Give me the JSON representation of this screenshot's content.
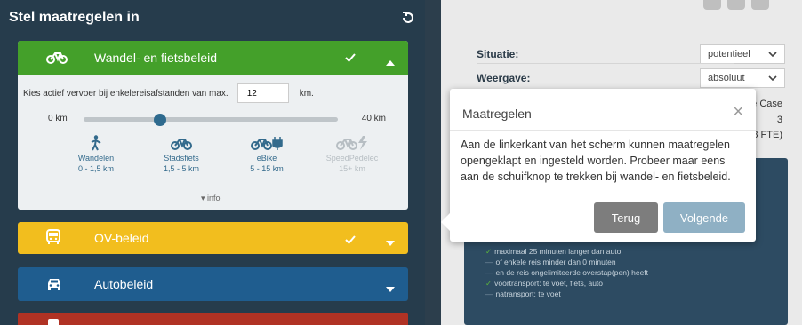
{
  "left_panel": {
    "title": "Stel maatregelen in",
    "sections": {
      "walk_bike": {
        "label": "Wandel- en fietsbeleid",
        "color": "#44a02a",
        "distance_text": "Kies actief vervoer bij enkelereisafstanden van max.",
        "distance_value": "12",
        "distance_unit": "km.",
        "slider_min": "0 km",
        "slider_max": "40 km",
        "slider_fraction": 0.3,
        "modes": [
          {
            "name": "Wandelen",
            "range": "0 - 1,5 km",
            "icon": "walking-icon"
          },
          {
            "name": "Stadsfiets",
            "range": "1,5 - 5 km",
            "icon": "bicycle-icon"
          },
          {
            "name": "eBike",
            "range": "5 - 15 km",
            "icon": "ebike-icon"
          },
          {
            "name": "SpeedPedelec",
            "range": "15+ km",
            "icon": "speedpedelec-icon"
          }
        ],
        "info_label": "info"
      },
      "ov": {
        "label": "OV-beleid",
        "color": "#f2be1e"
      },
      "auto": {
        "label": "Autobeleid",
        "color": "#1f5d8f"
      }
    }
  },
  "right_panel": {
    "situatie_label": "Situatie:",
    "situatie_value": "potentieel",
    "weergave_label": "Weergave:",
    "weergave_value": "absoluut",
    "partial_1": "e Case",
    "partial_2": "3",
    "partial_3": ",8 FTE)",
    "list": [
      {
        "mark": "check",
        "text": "maximaal 25 minuten langer dan auto"
      },
      {
        "mark": "dash",
        "text": "of enkele reis minder dan 0 minuten"
      },
      {
        "mark": "dash",
        "text": "en de reis ongelimiteerde overstap(pen) heeft"
      },
      {
        "mark": "check",
        "text": "voortransport: te voet, fiets, auto"
      },
      {
        "mark": "dash",
        "text": "natransport: te voet"
      }
    ]
  },
  "dialog": {
    "title": "Maatregelen",
    "body": "Aan de linkerkant van het scherm kunnen maatregelen opengeklapt en ingesteld worden. Probeer maar eens aan de schuifknop te trekken bij wandel- en fietsbeleid.",
    "back_label": "Terug",
    "next_label": "Volgende"
  }
}
